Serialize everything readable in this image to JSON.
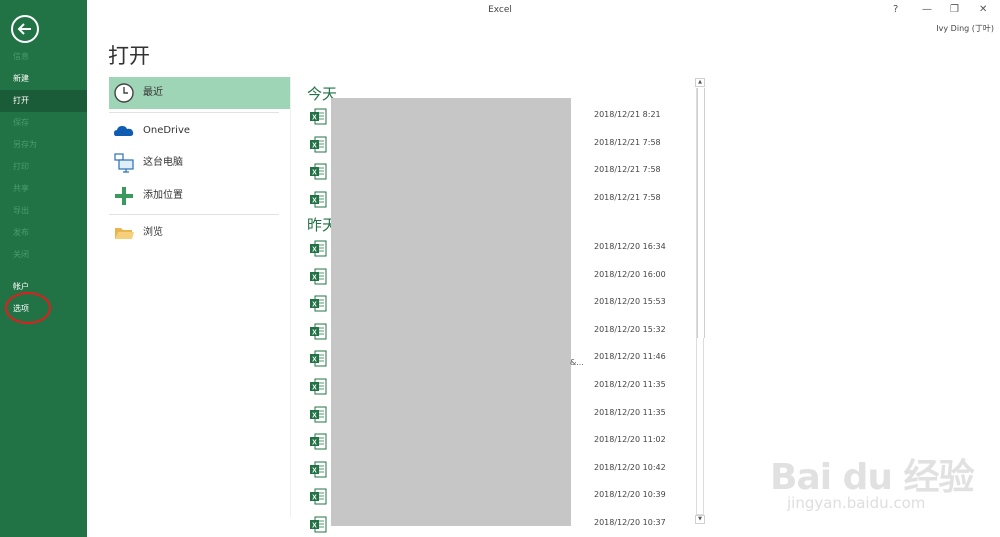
{
  "app": {
    "title": "Excel",
    "user": "Ivy Ding (丁叶)"
  },
  "window_controls": {
    "help": "?",
    "minimize": "—",
    "restore": "❐",
    "close": "✕"
  },
  "sidebar": {
    "items": [
      {
        "label": "信息",
        "enabled": false
      },
      {
        "label": "新建",
        "enabled": true
      },
      {
        "label": "打开",
        "enabled": true,
        "active": true
      },
      {
        "label": "保存",
        "enabled": false
      },
      {
        "label": "另存为",
        "enabled": false
      },
      {
        "label": "打印",
        "enabled": false
      },
      {
        "label": "共享",
        "enabled": false
      },
      {
        "label": "导出",
        "enabled": false
      },
      {
        "label": "发布",
        "enabled": false
      },
      {
        "label": "关闭",
        "enabled": false
      },
      {
        "label": "帐户",
        "enabled": true
      },
      {
        "label": "选项",
        "enabled": true,
        "highlighted": true
      }
    ]
  },
  "main": {
    "heading": "打开",
    "locations": [
      {
        "label": "最近",
        "icon": "clock-icon",
        "selected": true
      },
      {
        "label": "OneDrive",
        "icon": "cloud-icon"
      },
      {
        "label": "这台电脑",
        "icon": "computer-icon"
      },
      {
        "label": "添加位置",
        "icon": "plus-icon"
      },
      {
        "label": "浏览",
        "icon": "folder-icon"
      }
    ],
    "groups": [
      {
        "title": "今天",
        "files": [
          {
            "date": "2018/12/21 8:21"
          },
          {
            "date": "2018/12/21 7:58"
          },
          {
            "date": "2018/12/21 7:58"
          },
          {
            "date": "2018/12/21 7:58"
          }
        ]
      },
      {
        "title": "昨天",
        "files": [
          {
            "date": "2018/12/20 16:34"
          },
          {
            "date": "2018/12/20 16:00"
          },
          {
            "date": "2018/12/20 15:53"
          },
          {
            "date": "2018/12/20 15:32"
          },
          {
            "date": "2018/12/20 11:46"
          },
          {
            "date": "2018/12/20 11:35"
          },
          {
            "date": "2018/12/20 11:35"
          },
          {
            "date": "2018/12/20 11:02"
          },
          {
            "date": "2018/12/20 10:42"
          },
          {
            "date": "2018/12/20 10:39"
          },
          {
            "date": "2018/12/20 10:37"
          }
        ]
      }
    ],
    "truncated_path": "&..."
  },
  "watermark": {
    "line1": "Bai du 经验",
    "line2": "jingyan.baidu.com"
  },
  "colors": {
    "excel_green": "#217346",
    "selected_bg": "#9fd5b7",
    "highlight_circle": "#e01e1e"
  }
}
